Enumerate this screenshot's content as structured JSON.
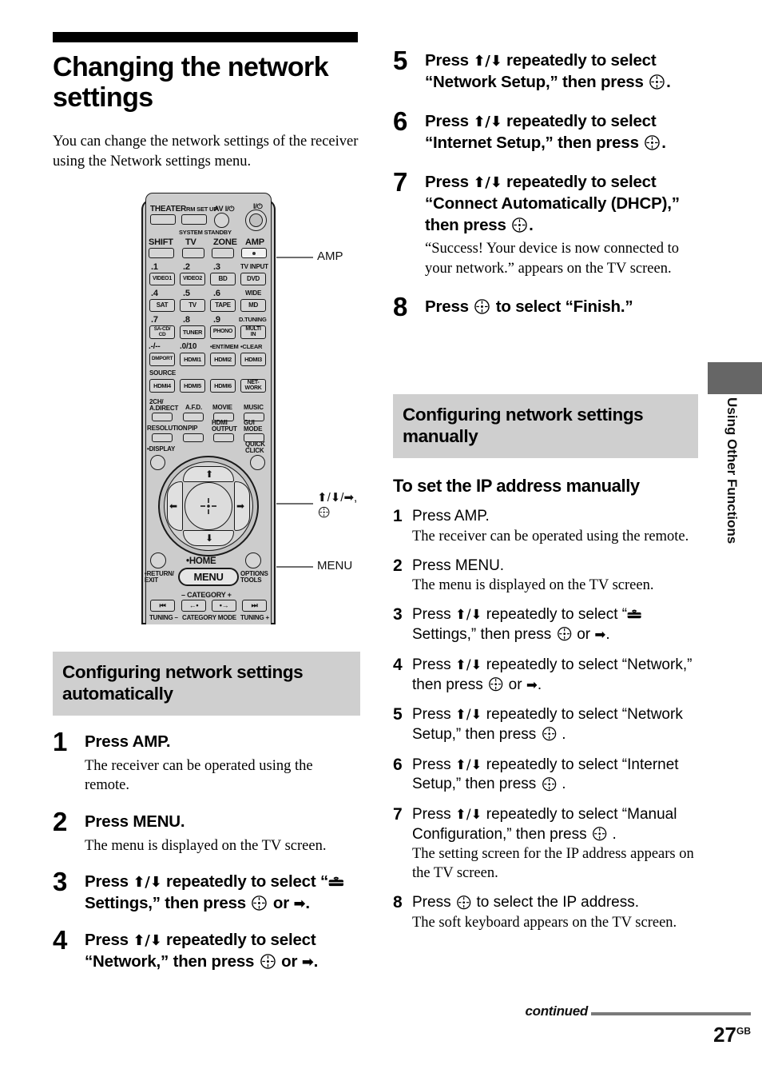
{
  "title": "Changing the network settings",
  "intro": "You can change the network settings of the receiver using the Network settings menu.",
  "figure": {
    "callouts": {
      "amp": "AMP",
      "nav": "⬆/⬇/➡,",
      "menu": "MENU"
    },
    "remote": {
      "top_labels": [
        "THEATER",
        "RM SET UP",
        "AV I/⏻",
        "I/⏻"
      ],
      "standby_label": "SYSTEM STANDBY",
      "row_mode": [
        "SHIFT",
        "TV",
        "ZONE",
        "AMP"
      ],
      "num_row1_nums": [
        ".1",
        ".2",
        ".3"
      ],
      "num_row1_right": "TV INPUT",
      "num_row1_btns": [
        "VIDEO1",
        "VIDEO2",
        "BD",
        "DVD"
      ],
      "num_row2_nums": [
        ".4",
        ".5",
        ".6"
      ],
      "num_row2_right": "WIDE",
      "num_row2_btns": [
        "SAT",
        "TV",
        "TAPE",
        "MD"
      ],
      "num_row3_nums": [
        ".7",
        ".8",
        ".9"
      ],
      "num_row3_right": "D.TUNING",
      "num_row3_btns": [
        "SA-CD/\nCD",
        "TUNER",
        "PHONO",
        "MULTI\nIN"
      ],
      "num_row4_nums": [
        ".-/--",
        ".0/10",
        "•ENT/MEM",
        "•CLEAR"
      ],
      "num_row4_btns": [
        "DMPORT",
        "HDMI1",
        "HDMI2",
        "HDMI3"
      ],
      "source_label": "SOURCE",
      "num_row5_btns": [
        "HDMI4",
        "HDMI5",
        "HDMI6",
        "NET-\nWORK"
      ],
      "fn_row1_labels": [
        "2CH/\nA.DIRECT",
        "A.F.D.",
        "MOVIE",
        "MUSIC"
      ],
      "fn_row2_labels": [
        "RESOLUTION",
        "PIP",
        "HDMI\nOUTPUT",
        "GUI\nMODE"
      ],
      "display_label": "•DISPLAY",
      "quick_click_label": "QUICK\nCLICK",
      "return_label": "•RETURN/\nEXIT",
      "home_label": "•HOME",
      "menu_label": "MENU",
      "options_label": "OPTIONS\nTOOLS",
      "category_label": "– CATEGORY +",
      "transport_row1": [
        "⏮",
        "←•",
        "•→",
        "⏭"
      ],
      "tuning_minus": "TUNING –",
      "category_mode": "CATEGORY MODE",
      "tuning_plus": "TUNING +"
    }
  },
  "left_section": {
    "heading": "Configuring network settings automatically",
    "steps": [
      {
        "num": "1",
        "instr_parts": [
          {
            "t": "text",
            "v": "Press AMP."
          }
        ],
        "desc": "The receiver can be operated using the remote."
      },
      {
        "num": "2",
        "instr_parts": [
          {
            "t": "text",
            "v": "Press MENU."
          }
        ],
        "desc": "The menu is displayed on the TV screen."
      },
      {
        "num": "3",
        "instr_parts": [
          {
            "t": "text",
            "v": "Press "
          },
          {
            "t": "arrow",
            "v": "⬆/⬇"
          },
          {
            "t": "text",
            "v": " repeatedly to select “"
          },
          {
            "t": "toolbox",
            "v": ""
          },
          {
            "t": "text",
            "v": "Settings,” then press "
          },
          {
            "t": "enter",
            "v": ""
          },
          {
            "t": "text",
            "v": " or "
          },
          {
            "t": "arrow",
            "v": "➡"
          },
          {
            "t": "text",
            "v": "."
          }
        ],
        "desc": ""
      },
      {
        "num": "4",
        "instr_parts": [
          {
            "t": "text",
            "v": "Press "
          },
          {
            "t": "arrow",
            "v": "⬆/⬇"
          },
          {
            "t": "text",
            "v": " repeatedly to select “Network,” then press "
          },
          {
            "t": "enter",
            "v": ""
          },
          {
            "t": "text",
            "v": " or "
          },
          {
            "t": "arrow",
            "v": "➡"
          },
          {
            "t": "text",
            "v": "."
          }
        ],
        "desc": ""
      }
    ]
  },
  "right_steps_auto": [
    {
      "num": "5",
      "instr_parts": [
        {
          "t": "text",
          "v": "Press "
        },
        {
          "t": "arrow",
          "v": "⬆/⬇"
        },
        {
          "t": "text",
          "v": " repeatedly to select “Network Setup,” then press "
        },
        {
          "t": "enter",
          "v": ""
        },
        {
          "t": "text",
          "v": "."
        }
      ],
      "desc": ""
    },
    {
      "num": "6",
      "instr_parts": [
        {
          "t": "text",
          "v": "Press "
        },
        {
          "t": "arrow",
          "v": "⬆/⬇"
        },
        {
          "t": "text",
          "v": " repeatedly to select “Internet Setup,” then press "
        },
        {
          "t": "enter",
          "v": ""
        },
        {
          "t": "text",
          "v": "."
        }
      ],
      "desc": ""
    },
    {
      "num": "7",
      "instr_parts": [
        {
          "t": "text",
          "v": "Press "
        },
        {
          "t": "arrow",
          "v": "⬆/⬇"
        },
        {
          "t": "text",
          "v": " repeatedly to select “Connect Automatically (DHCP),” then press "
        },
        {
          "t": "enter",
          "v": ""
        },
        {
          "t": "text",
          "v": "."
        }
      ],
      "desc": "“Success! Your device is now connected to your network.” appears on the TV screen."
    },
    {
      "num": "8",
      "instr_parts": [
        {
          "t": "text",
          "v": "Press "
        },
        {
          "t": "enter",
          "v": ""
        },
        {
          "t": "text",
          "v": " to select “Finish.”"
        }
      ],
      "desc": ""
    }
  ],
  "right_section": {
    "heading": "Configuring network settings manually",
    "subhead": "To set the IP address manually",
    "steps": [
      {
        "num": "1",
        "instr_parts": [
          {
            "t": "text",
            "v": "Press AMP."
          }
        ],
        "desc": "The receiver can be operated using the remote."
      },
      {
        "num": "2",
        "instr_parts": [
          {
            "t": "text",
            "v": "Press MENU."
          }
        ],
        "desc": "The menu is displayed on the TV screen."
      },
      {
        "num": "3",
        "instr_parts": [
          {
            "t": "text",
            "v": "Press "
          },
          {
            "t": "arrow",
            "v": "⬆/⬇"
          },
          {
            "t": "text",
            "v": " repeatedly to select “"
          },
          {
            "t": "toolbox",
            "v": ""
          },
          {
            "t": "text",
            "v": "Settings,” then press "
          },
          {
            "t": "enter",
            "v": ""
          },
          {
            "t": "text",
            "v": " or "
          },
          {
            "t": "arrow",
            "v": "➡"
          },
          {
            "t": "text",
            "v": "."
          }
        ],
        "desc": ""
      },
      {
        "num": "4",
        "instr_parts": [
          {
            "t": "text",
            "v": "Press "
          },
          {
            "t": "arrow",
            "v": "⬆/⬇"
          },
          {
            "t": "text",
            "v": " repeatedly to select “Network,” then press "
          },
          {
            "t": "enter",
            "v": ""
          },
          {
            "t": "text",
            "v": " or "
          },
          {
            "t": "arrow",
            "v": "➡"
          },
          {
            "t": "text",
            "v": "."
          }
        ],
        "desc": ""
      },
      {
        "num": "5",
        "instr_parts": [
          {
            "t": "text",
            "v": "Press "
          },
          {
            "t": "arrow",
            "v": "⬆/⬇"
          },
          {
            "t": "text",
            "v": " repeatedly to select “Network Setup,” then press "
          },
          {
            "t": "enter",
            "v": ""
          },
          {
            "t": "text",
            "v": " ."
          }
        ],
        "desc": ""
      },
      {
        "num": "6",
        "instr_parts": [
          {
            "t": "text",
            "v": "Press "
          },
          {
            "t": "arrow",
            "v": "⬆/⬇"
          },
          {
            "t": "text",
            "v": " repeatedly to select “Internet Setup,” then press "
          },
          {
            "t": "enter",
            "v": ""
          },
          {
            "t": "text",
            "v": " ."
          }
        ],
        "desc": ""
      },
      {
        "num": "7",
        "instr_parts": [
          {
            "t": "text",
            "v": "Press "
          },
          {
            "t": "arrow",
            "v": "⬆/⬇"
          },
          {
            "t": "text",
            "v": " repeatedly to select “Manual Configuration,” then press "
          },
          {
            "t": "enter",
            "v": ""
          },
          {
            "t": "text",
            "v": " ."
          }
        ],
        "desc": "The setting screen for the IP address appears on the TV screen."
      },
      {
        "num": "8",
        "instr_parts": [
          {
            "t": "text",
            "v": "Press "
          },
          {
            "t": "enter",
            "v": ""
          },
          {
            "t": "text",
            "v": " to select the IP address."
          }
        ],
        "desc": "The soft keyboard appears on the TV screen."
      }
    ]
  },
  "side_tab": "Using Other Functions",
  "footer": {
    "continued": "continued",
    "page_number": "27",
    "page_suffix": "GB"
  },
  "colors": {
    "shade": "#cfcfcf",
    "tab": "#666666",
    "rule": "#7a7a7a",
    "remote_body": "#c9c9c9"
  }
}
